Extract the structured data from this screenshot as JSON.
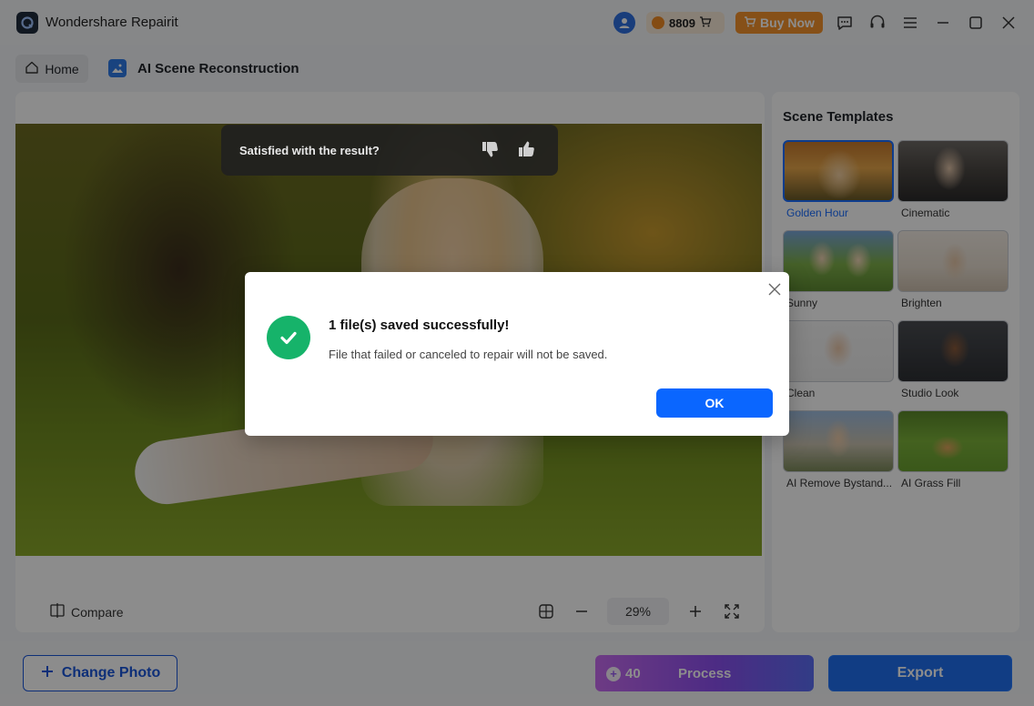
{
  "app": {
    "title": "Wondershare Repairit",
    "credits": "8809",
    "buy_now": "Buy Now"
  },
  "breadcrumb": {
    "home": "Home",
    "page_title": "AI Scene Reconstruction"
  },
  "feedback": {
    "question": "Satisfied with the result?"
  },
  "controls": {
    "compare": "Compare",
    "zoom": "29%"
  },
  "side_panel": {
    "title": "Scene Templates",
    "templates": [
      {
        "label": "Golden Hour",
        "selected": true
      },
      {
        "label": "Cinematic",
        "selected": false
      },
      {
        "label": "Sunny",
        "selected": false
      },
      {
        "label": "Brighten",
        "selected": false
      },
      {
        "label": "Clean",
        "selected": false
      },
      {
        "label": "Studio Look",
        "selected": false
      },
      {
        "label": "AI Remove Bystand...",
        "selected": false
      },
      {
        "label": "AI Grass Fill",
        "selected": false
      }
    ]
  },
  "bottom": {
    "change_photo": "Change Photo",
    "process_cost": "40",
    "process": "Process",
    "export": "Export"
  },
  "modal": {
    "title": "1 file(s) saved successfully!",
    "message": "File that failed or canceled to repair will not be saved.",
    "ok": "OK"
  },
  "colors": {
    "primary": "#0a66ff",
    "success": "#16b36a",
    "buy_now": "#f4922c"
  }
}
